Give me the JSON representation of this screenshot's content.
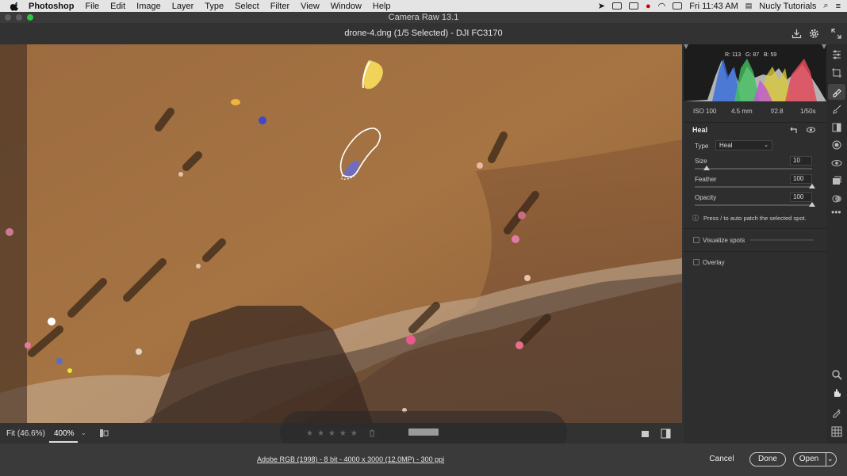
{
  "menubar": {
    "app": "Photoshop",
    "items": [
      "File",
      "Edit",
      "Image",
      "Layer",
      "Type",
      "Select",
      "Filter",
      "View",
      "Window",
      "Help"
    ],
    "clock": "Fri 11:43 AM",
    "user": "Nucly Tutorials"
  },
  "window": {
    "title": "Camera Raw 13.1",
    "document": "drone-4.dng (1/5 Selected)  -  DJI FC3170"
  },
  "histogram": {
    "r_label": "R:",
    "r": "113",
    "g_label": "G:",
    "g": "87",
    "b_label": "B:",
    "b": "59"
  },
  "exif": {
    "iso": "ISO 100",
    "focal": "4.5 mm",
    "aperture": "f/2.8",
    "shutter": "1/50s"
  },
  "heal_panel": {
    "title": "Heal",
    "type_label": "Type",
    "type_value": "Heal",
    "size_label": "Size",
    "size_value": "10",
    "size_fraction": 0.1,
    "feather_label": "Feather",
    "feather_value": "100",
    "feather_fraction": 1.0,
    "opacity_label": "Opacity",
    "opacity_value": "100",
    "opacity_fraction": 1.0,
    "hint": "Press / to auto patch the selected spot.",
    "visualize_label": "Visualize spots",
    "overlay_label": "Overlay"
  },
  "status": {
    "fit": "Fit (46.6%)",
    "zoom": "400%",
    "stars": "★★★★★"
  },
  "footer": {
    "info": "Adobe RGB (1998) - 8 bit - 4000 x 3000 (12.0MP) - 300 ppi",
    "cancel": "Cancel",
    "done": "Done",
    "open": "Open"
  },
  "colors": {
    "sand": "#9a6a3f",
    "panel": "#2e2e2e",
    "accent": "#ffffff"
  }
}
